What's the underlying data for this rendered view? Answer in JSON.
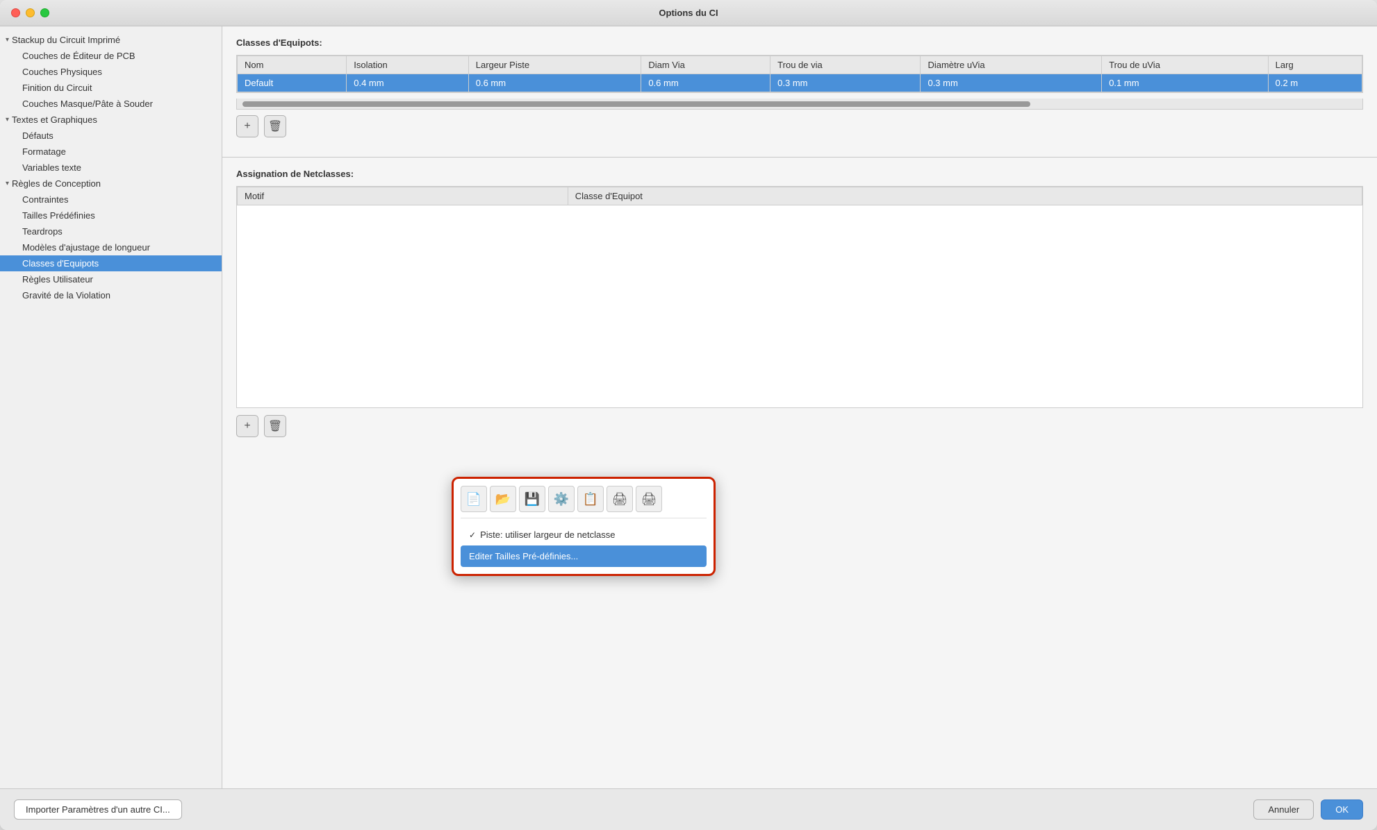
{
  "window": {
    "title": "Options du CI"
  },
  "sidebar": {
    "items": [
      {
        "id": "stackup",
        "label": "Stackup du Circuit Imprimé",
        "type": "group-header",
        "expanded": true
      },
      {
        "id": "couches-editeur",
        "label": "Couches de Éditeur de PCB",
        "type": "child"
      },
      {
        "id": "couches-physiques",
        "label": "Couches Physiques",
        "type": "child"
      },
      {
        "id": "finition",
        "label": "Finition du Circuit",
        "type": "child"
      },
      {
        "id": "couches-masque",
        "label": "Couches Masque/Pâte à Souder",
        "type": "child"
      },
      {
        "id": "textes",
        "label": "Textes et Graphiques",
        "type": "group-header",
        "expanded": true
      },
      {
        "id": "defauts",
        "label": "Défauts",
        "type": "child"
      },
      {
        "id": "formatage",
        "label": "Formatage",
        "type": "child"
      },
      {
        "id": "variables",
        "label": "Variables texte",
        "type": "child"
      },
      {
        "id": "regles",
        "label": "Règles de Conception",
        "type": "group-header",
        "expanded": true
      },
      {
        "id": "contraintes",
        "label": "Contraintes",
        "type": "child"
      },
      {
        "id": "tailles",
        "label": "Tailles Prédéfinies",
        "type": "child"
      },
      {
        "id": "teardrops",
        "label": "Teardrops",
        "type": "child"
      },
      {
        "id": "modeles",
        "label": "Modèles d'ajustage de longueur",
        "type": "child"
      },
      {
        "id": "classes-equipots",
        "label": "Classes d'Equipots",
        "type": "child",
        "active": true
      },
      {
        "id": "regles-utilisateur",
        "label": "Règles Utilisateur",
        "type": "child"
      },
      {
        "id": "gravite",
        "label": "Gravité de la Violation",
        "type": "child"
      }
    ]
  },
  "main": {
    "upper_section_title": "Classes d'Equipots:",
    "table": {
      "columns": [
        "Nom",
        "Isolation",
        "Largeur Piste",
        "Diam Via",
        "Trou de via",
        "Diamètre uVia",
        "Trou de uVia",
        "Larg"
      ],
      "rows": [
        {
          "nom": "Default",
          "isolation": "0.4 mm",
          "largeur_piste": "0.6 mm",
          "diam_via": "0.6 mm",
          "trou_via": "0.3 mm",
          "diam_uvia": "0.3 mm",
          "trou_uvia": "0.1 mm",
          "larg": "0.2 m"
        }
      ]
    },
    "add_btn": "+",
    "delete_btn": "🗑",
    "lower_section_title": "Assignation de Netclasses:",
    "netclass_table": {
      "columns": [
        "Motif",
        "Classe d'Equipot"
      ],
      "rows": []
    }
  },
  "popup": {
    "toolbar_icons": [
      "new-file",
      "open-folder",
      "save",
      "settings-green",
      "copy",
      "print",
      "export"
    ],
    "menu_item1": {
      "checkmark": "✓",
      "label": "Piste: utiliser largeur de netclasse"
    },
    "menu_item2": {
      "label": "Editer Tailles Pré-définies..."
    }
  },
  "footer": {
    "import_btn": "Importer Paramètres d'un autre CI...",
    "cancel_btn": "Annuler",
    "ok_btn": "OK"
  }
}
